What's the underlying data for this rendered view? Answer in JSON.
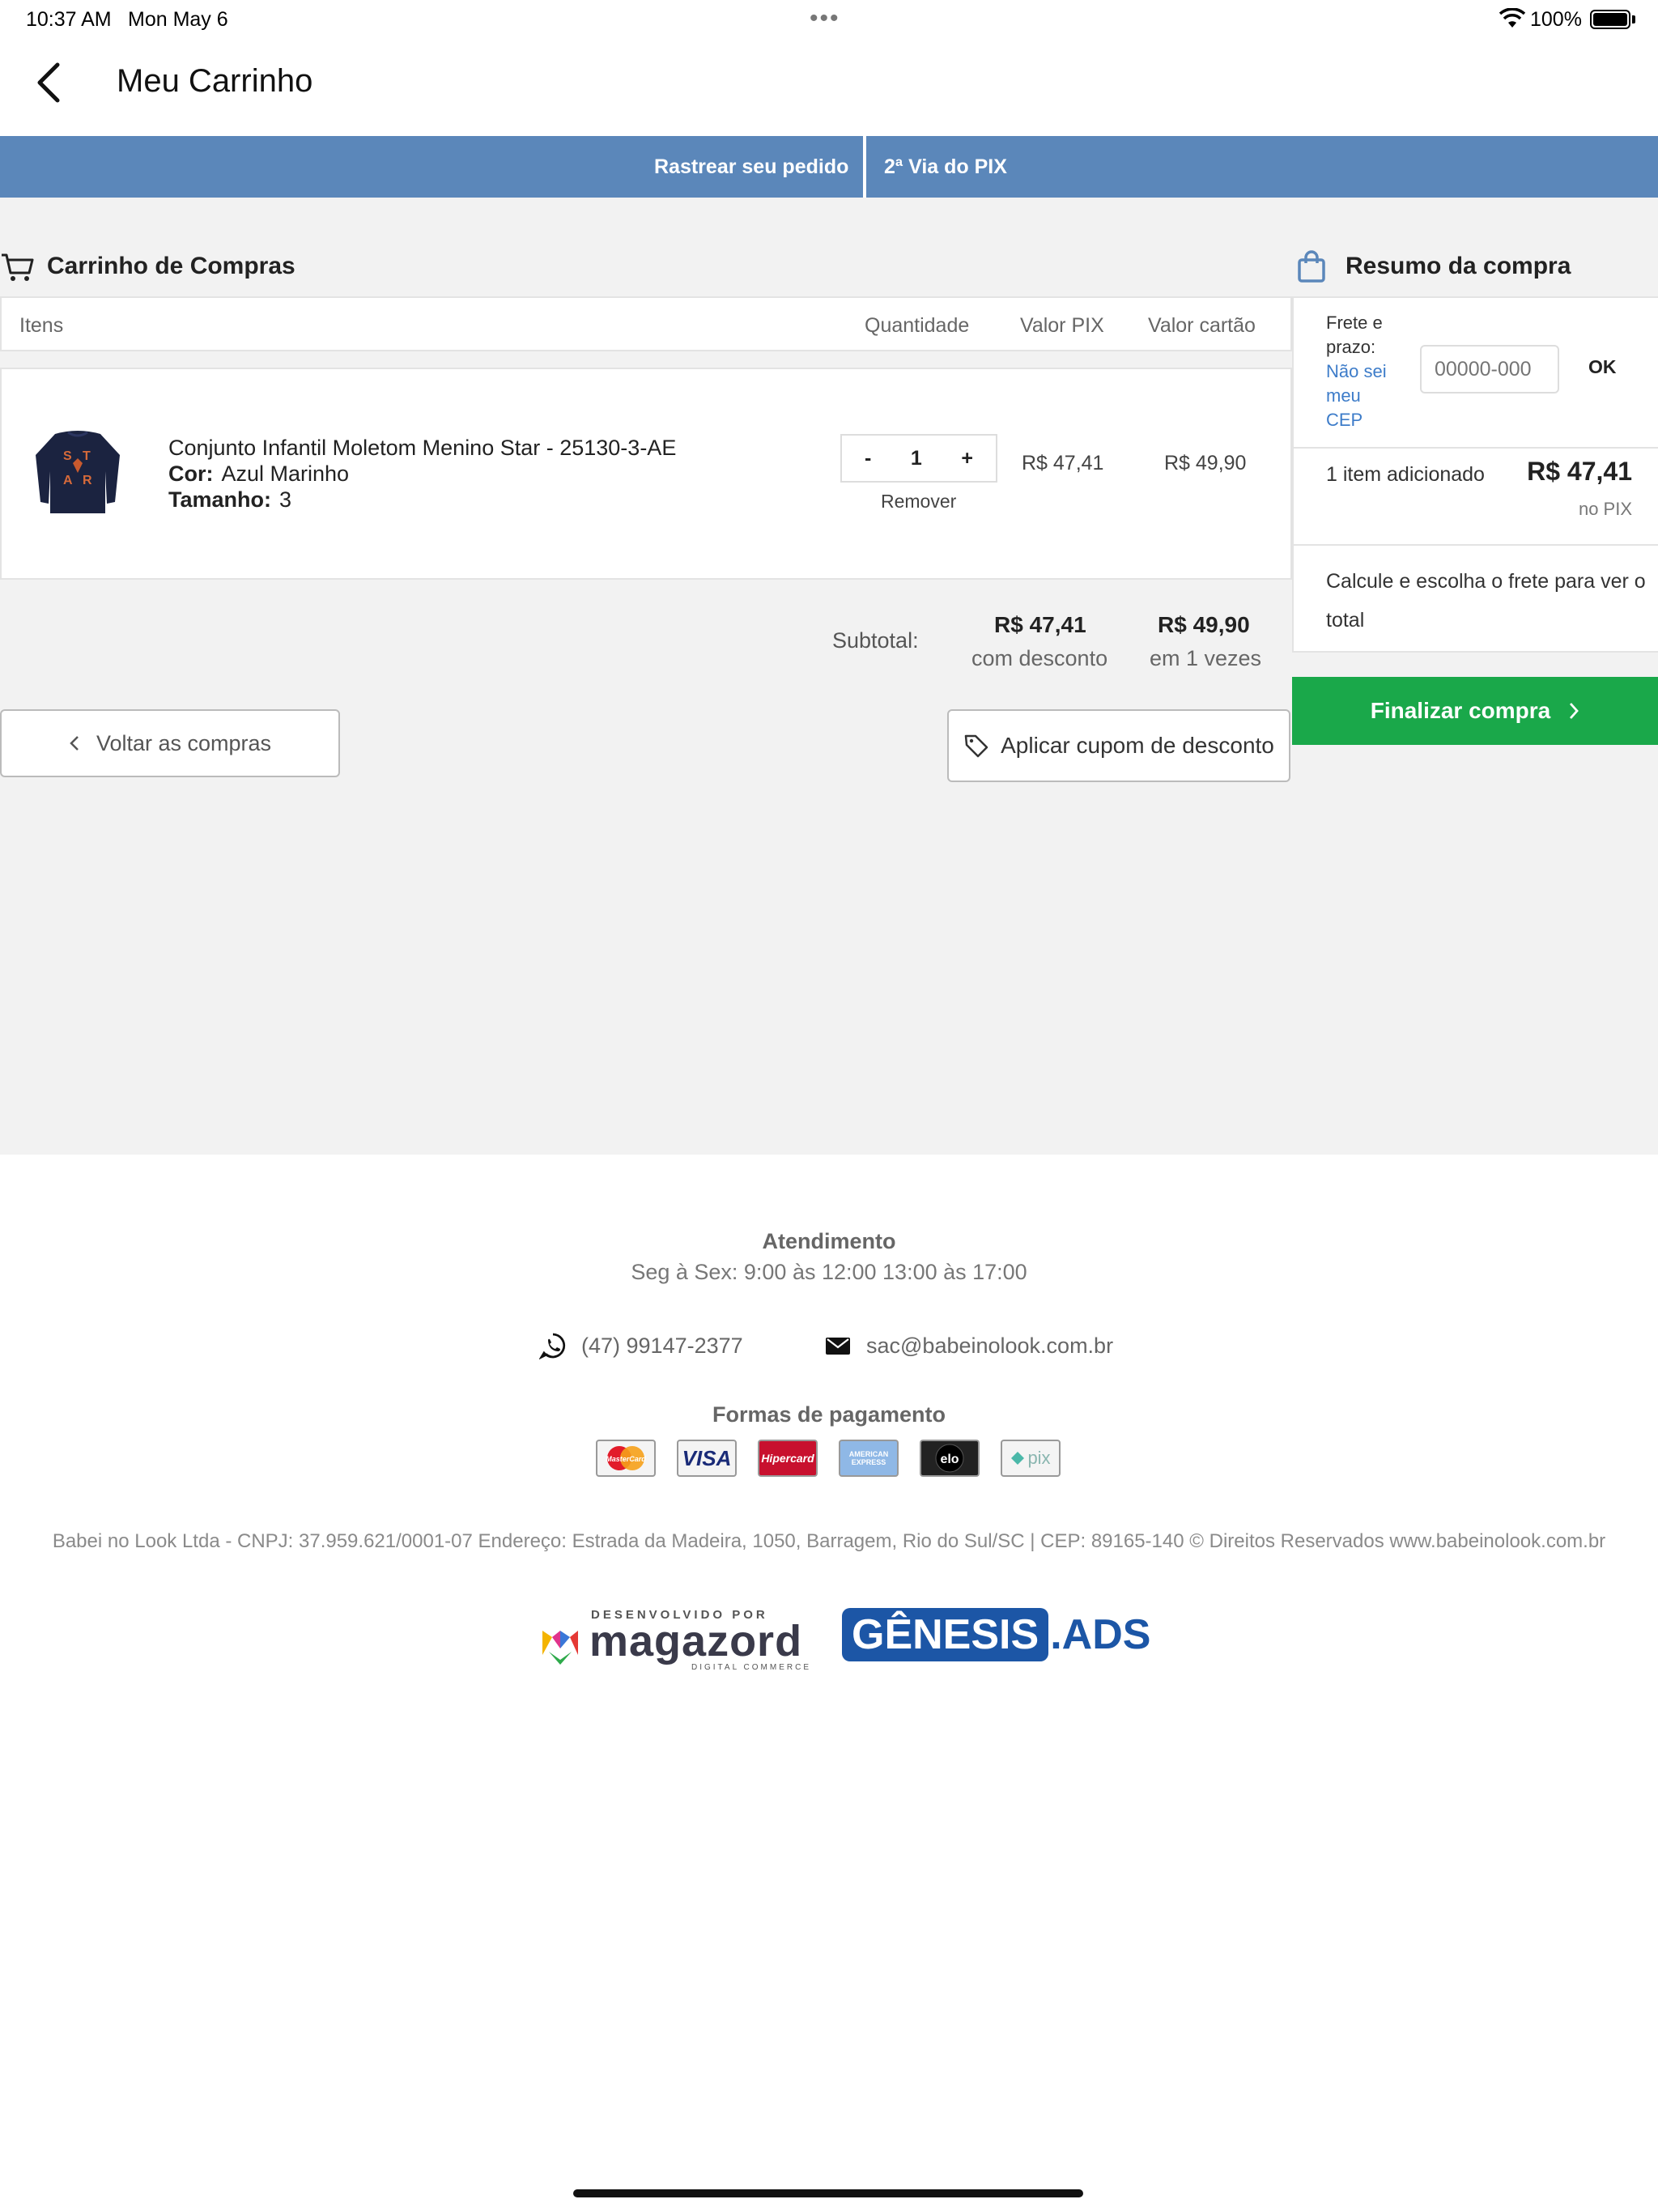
{
  "status_bar": {
    "time": "10:37 AM",
    "date": "Mon May 6",
    "battery": "100%"
  },
  "nav": {
    "title": "Meu Carrinho",
    "back_icon": "chevron-left-icon"
  },
  "top_links": {
    "track": "Rastrear seu pedido",
    "pix": "2ª Via do PIX"
  },
  "cart": {
    "title": "Carrinho de Compras",
    "columns": {
      "items": "Itens",
      "quantity": "Quantidade",
      "pix": "Valor PIX",
      "card": "Valor cartão"
    },
    "items": [
      {
        "name": "Conjunto Infantil Moletom Menino Star - 25130-3-AE",
        "color_label": "Cor:",
        "color": "Azul Marinho",
        "size_label": "Tamanho:",
        "size": "3",
        "qty_minus": "-",
        "quantity": "1",
        "qty_plus": "+",
        "remove": "Remover",
        "price_pix": "R$ 47,41",
        "price_card": "R$ 49,90"
      }
    ],
    "subtotal": {
      "label": "Subtotal:",
      "pix_value": "R$ 47,41",
      "pix_note": "com desconto",
      "card_value": "R$ 49,90",
      "card_note": "em 1 vezes"
    },
    "back_button": "Voltar as compras",
    "coupon_button": "Aplicar cupom de desconto"
  },
  "summary": {
    "title": "Resumo da compra",
    "frete_label": "Frete e prazo:",
    "cep_link": "Não sei meu CEP",
    "cep_placeholder": "00000-000",
    "ok": "OK",
    "items_added": "1 item adicionado",
    "total": "R$ 47,41",
    "total_note": "no PIX",
    "calc_note": "Calcule e escolha o frete para ver o total",
    "checkout": "Finalizar compra"
  },
  "footer": {
    "support_title": "Atendimento",
    "support_hours": "Seg à Sex: 9:00 às 12:00 13:00 às 17:00",
    "phone": "(47) 99147-2377",
    "email": "sac@babeinolook.com.br",
    "payment_title": "Formas de pagamento",
    "payment_methods": [
      "MasterCard",
      "VISA",
      "Hipercard",
      "AMERICAN EXPRESS",
      "elo",
      "pix"
    ],
    "legal": "Babei no Look Ltda - CNPJ: 37.959.621/0001-07 Endereço: Estrada da Madeira, 1050, Barragem, Rio do Sul/SC | CEP: 89165-140 © Direitos Reservados www.babeinolook.com.br",
    "dev_small": "DESENVOLVIDO POR",
    "dev_name": "magazord",
    "dev_sub": "DIGITAL COMMERCE",
    "partner_main": "GÊNESIS",
    "partner_suffix": ".ADS"
  },
  "colors": {
    "blue_bar": "#5b87ba",
    "checkout_green": "#1aa84a",
    "link_blue": "#3d7cc9"
  }
}
